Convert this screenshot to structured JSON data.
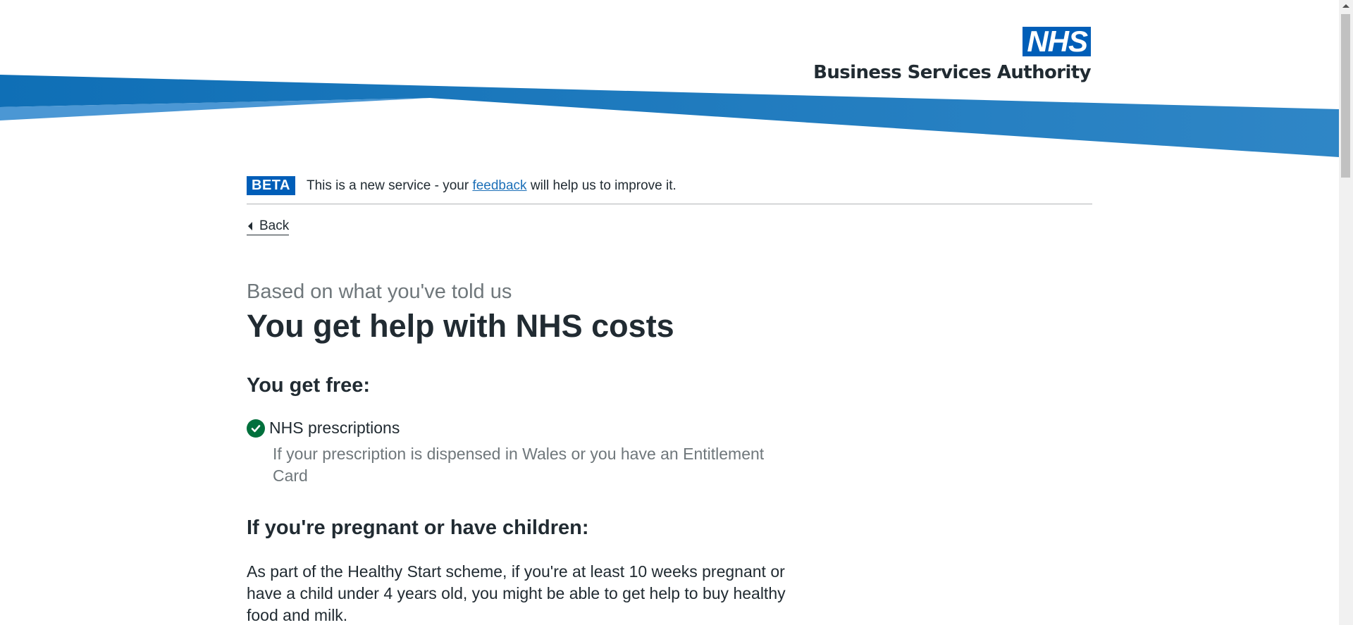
{
  "header": {
    "logo_text": "NHS",
    "org_name": "Business Services Authority"
  },
  "beta_banner": {
    "tag": "BETA",
    "text_before": "This is a new service - your ",
    "link_text": "feedback",
    "text_after": " will help us to improve it."
  },
  "nav": {
    "back_label": "Back"
  },
  "result": {
    "caption": "Based on what you've told us",
    "title": "You get help with NHS costs",
    "free_heading": "You get free:",
    "benefits": [
      {
        "label": "NHS prescriptions",
        "hint": "If your prescription is dispensed in Wales or you have an Entitlement Card"
      }
    ],
    "pregnant_heading": "If you're pregnant or have children:",
    "healthy_start_text": "As part of the Healthy Start scheme, if you're at least 10 weeks pregnant or have a child under 4 years old, you might be able to get help to buy healthy food and milk."
  },
  "colors": {
    "nhs_blue": "#005eb8",
    "success_green": "#00703c",
    "text": "#212b32",
    "secondary_text": "#6f777b",
    "link": "#1d70b8"
  },
  "icons": {
    "back": "chevron-left-icon",
    "benefit": "check-circle-icon"
  }
}
